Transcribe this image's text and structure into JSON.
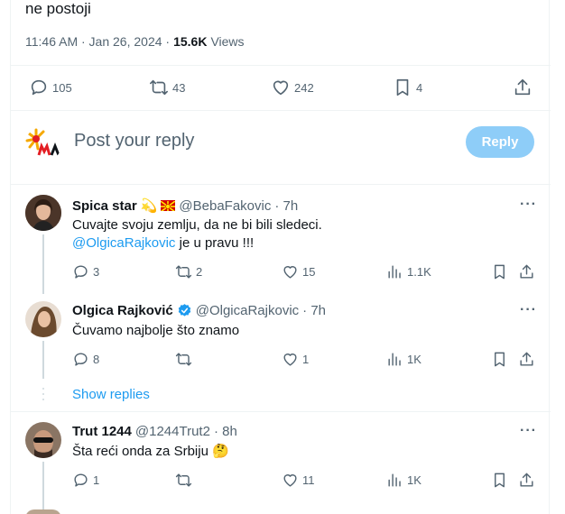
{
  "main_tweet": {
    "text": "ne postoji",
    "time": "11:46 AM · Jan 26, 2024 ·",
    "views_count": "15.6K",
    "views_label": "Views",
    "replies": "105",
    "retweets": "43",
    "likes": "242",
    "bookmarks": "4"
  },
  "reply_box": {
    "placeholder": "Post your reply",
    "button": "Reply"
  },
  "replies": [
    {
      "name": "Spica star",
      "handle": "@BebaFakovic",
      "time": "· 7h",
      "text_line1": "Cuvajte svoju zemlju, da ne bi bili sledeci.",
      "mention": "@OlgicaRajkovic",
      "text_line2_rest": " je u pravu !!!",
      "replies": "3",
      "retweets": "2",
      "likes": "15",
      "views": "1.1K"
    },
    {
      "name": "Olgica Rajković",
      "handle": "@OlgicaRajkovic",
      "time": "· 7h",
      "text": "Čuvamo najbolje što znamo",
      "replies": "8",
      "retweets": "",
      "likes": "1",
      "views": "1K"
    },
    {
      "name": "Trut 1244",
      "handle": "@1244Trut2",
      "time": "· 8h",
      "text": "Šta reći onda za Srbiju 🤔",
      "replies": "1",
      "retweets": "",
      "likes": "11",
      "views": "1K"
    }
  ],
  "show_replies": "Show replies",
  "colors": {
    "accent": "#1d9bf0",
    "muted": "#536471",
    "reply_button": "#8ecdf8"
  },
  "icons": [
    "reply-icon",
    "retweet-icon",
    "like-icon",
    "bookmark-icon",
    "share-icon",
    "views-icon",
    "more-icon",
    "verified-icon"
  ]
}
